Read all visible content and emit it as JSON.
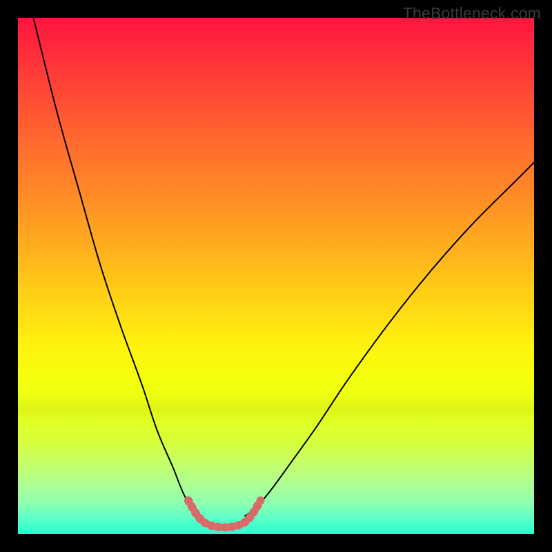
{
  "watermark": "TheBottleneck.com",
  "chart_data": {
    "type": "line",
    "title": "",
    "xlabel": "",
    "ylabel": "",
    "xlim": [
      0,
      100
    ],
    "ylim": [
      0,
      100
    ],
    "grid": false,
    "legend": false,
    "background": {
      "gradient_top": "#ff153f",
      "gradient_mid": "#fff40e",
      "gradient_bottom": "#23ffcf"
    },
    "series": [
      {
        "name": "left-branch",
        "color": "#000000",
        "stroke_width": 2,
        "x": [
          3.0,
          7.5,
          12.0,
          16.0,
          20.0,
          24.0,
          27.0,
          30.0,
          32.0,
          34.0,
          35.0
        ],
        "y": [
          100.0,
          82.0,
          66.0,
          52.0,
          40.0,
          29.0,
          20.0,
          13.0,
          8.0,
          4.5,
          3.5
        ]
      },
      {
        "name": "right-branch",
        "color": "#000000",
        "stroke_width": 2,
        "x": [
          44.0,
          46.0,
          49.0,
          53.0,
          58.0,
          64.0,
          72.0,
          80.0,
          88.0,
          96.0,
          100.0
        ],
        "y": [
          3.5,
          5.0,
          8.5,
          14.0,
          21.0,
          30.0,
          41.0,
          51.0,
          60.0,
          68.0,
          72.0
        ]
      },
      {
        "name": "optimal-zone",
        "color": "#d86a6a",
        "stroke_width": 10,
        "x": [
          33.0,
          35.0,
          37.0,
          40.0,
          43.0,
          45.0,
          47.0
        ],
        "y": [
          6.5,
          3.3,
          1.8,
          1.3,
          1.8,
          3.3,
          6.5
        ]
      }
    ]
  }
}
